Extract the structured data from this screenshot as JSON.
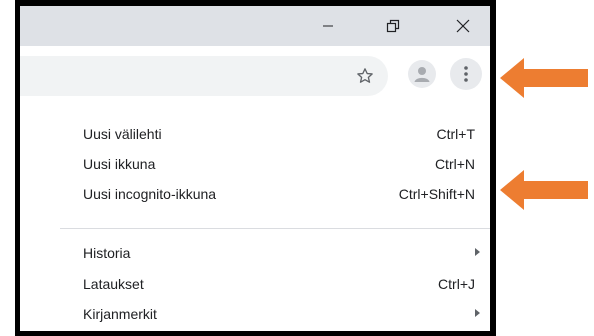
{
  "window_controls": {
    "minimize_icon": "minimize-icon",
    "restore_icon": "restore-icon",
    "close_icon": "close-icon"
  },
  "toolbar": {
    "bookmark_icon": "star-icon",
    "profile_icon": "profile-avatar-icon",
    "menu_icon": "vertical-dots-icon"
  },
  "menu": {
    "items": [
      {
        "label": "Uusi välilehti",
        "shortcut": "Ctrl+T"
      },
      {
        "label": "Uusi ikkuna",
        "shortcut": "Ctrl+N"
      },
      {
        "label": "Uusi incognito-ikkuna",
        "shortcut": "Ctrl+Shift+N"
      },
      {
        "label": "Historia",
        "shortcut": ""
      },
      {
        "label": "Lataukset",
        "shortcut": "Ctrl+J"
      },
      {
        "label": "Kirjanmerkit",
        "shortcut": ""
      }
    ]
  },
  "colors": {
    "annotation_arrow": "#ed7d31",
    "titlebar": "#dee1e6",
    "omnibox": "#f1f3f4"
  }
}
